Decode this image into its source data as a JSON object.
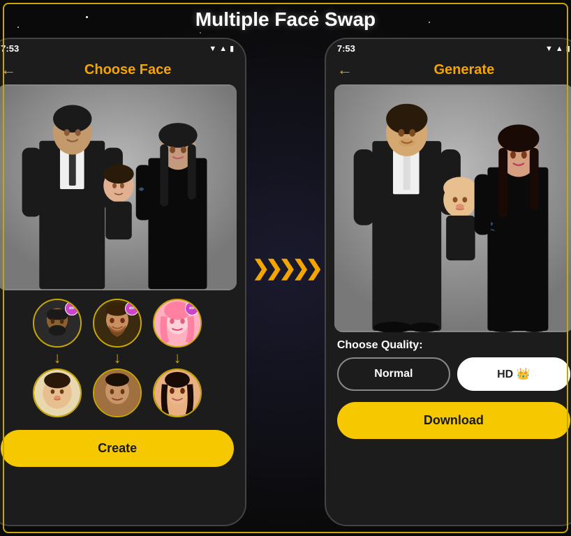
{
  "page": {
    "title": "Multiple Face Swap",
    "background": "#0a0a0a"
  },
  "left_phone": {
    "status_time": "7:53",
    "header_title": "Choose Face",
    "back_arrow": "←",
    "create_button": "Create",
    "face_pairs": [
      {
        "source_emoji": "👤",
        "source_label": "face1",
        "result_emoji": "👶",
        "result_label": "result1"
      },
      {
        "source_emoji": "👤",
        "source_label": "face2",
        "result_emoji": "🧑",
        "result_label": "result2"
      },
      {
        "source_emoji": "👤",
        "source_label": "face3",
        "result_emoji": "👩",
        "result_label": "result3"
      }
    ]
  },
  "right_phone": {
    "status_time": "7:53",
    "header_title": "Generate",
    "back_arrow": "←",
    "quality_label": "Choose Quality:",
    "quality_normal": "Normal",
    "quality_hd": "HD 👑",
    "download_button": "Download"
  },
  "arrow": {
    "chevrons": "❯❯❯❯❯"
  }
}
